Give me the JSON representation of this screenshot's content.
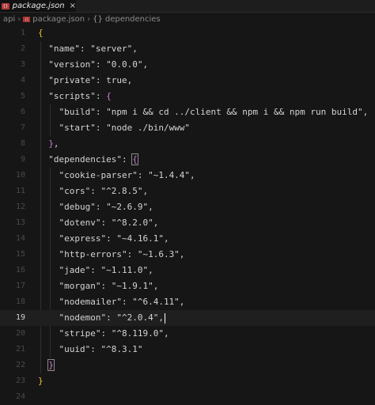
{
  "tab": {
    "icon_text": "{}",
    "label": "package.json",
    "close": "×"
  },
  "breadcrumb": {
    "root": "api",
    "file": "package.json",
    "symbol_icon": "{}",
    "symbol": "dependencies",
    "separator": "›"
  },
  "editor": {
    "active_line": 19,
    "lines": [
      {
        "n": "1",
        "text": "{"
      },
      {
        "n": "2",
        "text": "  \"name\": \"server\","
      },
      {
        "n": "3",
        "text": "  \"version\": \"0.0.0\","
      },
      {
        "n": "4",
        "text": "  \"private\": true,"
      },
      {
        "n": "5",
        "text": "  \"scripts\": {"
      },
      {
        "n": "6",
        "text": "    \"build\": \"npm i && cd ../client && npm i && npm run build\","
      },
      {
        "n": "7",
        "text": "    \"start\": \"node ./bin/www\""
      },
      {
        "n": "8",
        "text": "  },"
      },
      {
        "n": "9",
        "text": "  \"dependencies\": {"
      },
      {
        "n": "10",
        "text": "    \"cookie-parser\": \"~1.4.4\","
      },
      {
        "n": "11",
        "text": "    \"cors\": \"^2.8.5\","
      },
      {
        "n": "12",
        "text": "    \"debug\": \"~2.6.9\","
      },
      {
        "n": "13",
        "text": "    \"dotenv\": \"^8.2.0\","
      },
      {
        "n": "14",
        "text": "    \"express\": \"~4.16.1\","
      },
      {
        "n": "15",
        "text": "    \"http-errors\": \"~1.6.3\","
      },
      {
        "n": "16",
        "text": "    \"jade\": \"~1.11.0\","
      },
      {
        "n": "17",
        "text": "    \"morgan\": \"~1.9.1\","
      },
      {
        "n": "18",
        "text": "    \"nodemailer\": \"^6.4.11\","
      },
      {
        "n": "19",
        "text": "    \"nodemon\": \"^2.0.4\","
      },
      {
        "n": "20",
        "text": "    \"stripe\": \"^8.119.0\","
      },
      {
        "n": "21",
        "text": "    \"uuid\": \"^8.3.1\""
      },
      {
        "n": "22",
        "text": "  }"
      },
      {
        "n": "23",
        "text": "}"
      },
      {
        "n": "24",
        "text": ""
      }
    ]
  },
  "colors": {
    "background": "#161616",
    "bracket_outer": "#f1c232",
    "bracket_inner": "#d27ad4",
    "line_number": "#4a4a4a",
    "json_icon": "#b03a3a"
  }
}
